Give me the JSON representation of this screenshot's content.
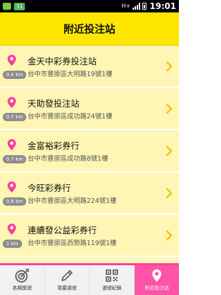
{
  "status_bar": {
    "badge": "31",
    "network": "H+",
    "time": "19:01"
  },
  "header": {
    "title": "附近投注站"
  },
  "stations": [
    {
      "name": "金天中彩券投注站",
      "address": "台中市豐原區大明路19號1樓",
      "distance": "0.4 km"
    },
    {
      "name": "天助發投注站",
      "address": "台中市豐原區成功路24號1樓",
      "distance": "0.7 km"
    },
    {
      "name": "金富裕彩券行",
      "address": "台中市豐原區成功路8號1樓",
      "distance": "0.7 km"
    },
    {
      "name": "今旺彩券行",
      "address": "台中市豐原區大明路224號1樓",
      "distance": "0.8 km"
    },
    {
      "name": "連續發公益彩券行",
      "address": "台中市豐原區西勢路119號1樓",
      "distance": "1 km"
    }
  ],
  "tabs": [
    {
      "label": "各期獎號",
      "icon": "target-icon"
    },
    {
      "label": "我要選號",
      "icon": "pencil-icon"
    },
    {
      "label": "選號紀錄",
      "icon": "qrcode-icon"
    },
    {
      "label": "附近投注站",
      "icon": "location-pin-icon"
    }
  ],
  "colors": {
    "header": "#ffe600",
    "row": "#fff5b5",
    "accent_pink": "#ff53a6",
    "chevron": "#f5c400"
  }
}
